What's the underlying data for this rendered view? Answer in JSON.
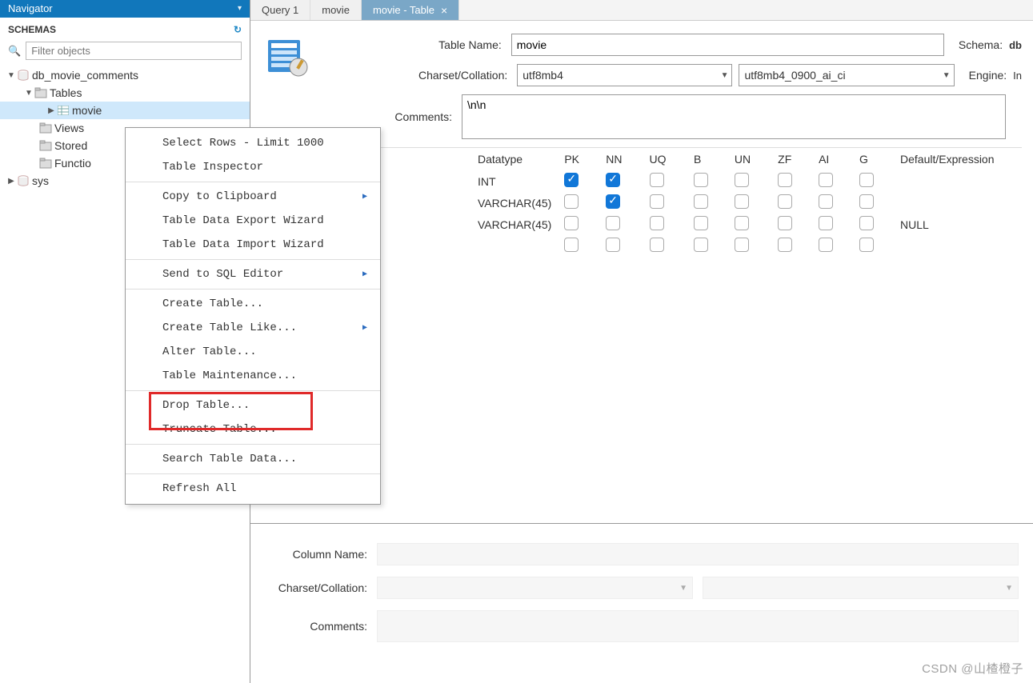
{
  "sidebar": {
    "nav_title": "Navigator",
    "schemas_label": "SCHEMAS",
    "filter_placeholder": "Filter objects",
    "tree": {
      "db": "db_movie_comments",
      "tables_label": "Tables",
      "table_items": [
        "movie"
      ],
      "views_label": "Views",
      "stored_label": "Stored",
      "functions_label": "Functio",
      "sys_label": "sys"
    }
  },
  "tabs": [
    "Query 1",
    "movie",
    "movie - Table"
  ],
  "form": {
    "table_name_label": "Table Name:",
    "table_name_value": "movie",
    "schema_label": "Schema:",
    "schema_value": "db",
    "charset_label": "Charset/Collation:",
    "charset_value": "utf8mb4",
    "collation_value": "utf8mb4_0900_ai_ci",
    "engine_label": "Engine:",
    "engine_value": "In",
    "comments_label": "Comments:",
    "comments_value": "\\n\\n"
  },
  "columns": {
    "headers": [
      "Datatype",
      "PK",
      "NN",
      "UQ",
      "B",
      "UN",
      "ZF",
      "AI",
      "G",
      "Default/Expression"
    ],
    "rows": [
      {
        "datatype": "INT",
        "pk": true,
        "nn": true,
        "uq": false,
        "b": false,
        "un": false,
        "zf": false,
        "ai": false,
        "g": false,
        "def": ""
      },
      {
        "datatype": "VARCHAR(45)",
        "pk": false,
        "nn": true,
        "uq": false,
        "b": false,
        "un": false,
        "zf": false,
        "ai": false,
        "g": false,
        "def": ""
      },
      {
        "datatype": "VARCHAR(45)",
        "pk": false,
        "nn": false,
        "uq": false,
        "b": false,
        "un": false,
        "zf": false,
        "ai": false,
        "g": false,
        "def": "NULL"
      },
      {
        "datatype": "",
        "pk": false,
        "nn": false,
        "uq": false,
        "b": false,
        "un": false,
        "zf": false,
        "ai": false,
        "g": false,
        "def": ""
      }
    ]
  },
  "ctx": {
    "items": [
      {
        "label": "Select Rows - Limit 1000",
        "sub": false,
        "sep": false
      },
      {
        "label": "Table Inspector",
        "sub": false,
        "sep": true
      },
      {
        "label": "Copy to Clipboard",
        "sub": true,
        "sep": false
      },
      {
        "label": "Table Data Export Wizard",
        "sub": false,
        "sep": false
      },
      {
        "label": "Table Data Import Wizard",
        "sub": false,
        "sep": true
      },
      {
        "label": "Send to SQL Editor",
        "sub": true,
        "sep": true
      },
      {
        "label": "Create Table...",
        "sub": false,
        "sep": false
      },
      {
        "label": "Create Table Like...",
        "sub": true,
        "sep": false
      },
      {
        "label": "Alter Table...",
        "sub": false,
        "sep": false
      },
      {
        "label": "Table Maintenance...",
        "sub": false,
        "sep": true
      },
      {
        "label": "Drop Table...",
        "sub": false,
        "sep": false
      },
      {
        "label": "Truncate Table...",
        "sub": false,
        "sep": true
      },
      {
        "label": "Search Table Data...",
        "sub": false,
        "sep": true
      },
      {
        "label": "Refresh All",
        "sub": false,
        "sep": false
      }
    ]
  },
  "bottom": {
    "column_name_label": "Column Name:",
    "charset_label": "Charset/Collation:",
    "comments_label": "Comments:"
  },
  "watermark": "CSDN @山楂橙子"
}
